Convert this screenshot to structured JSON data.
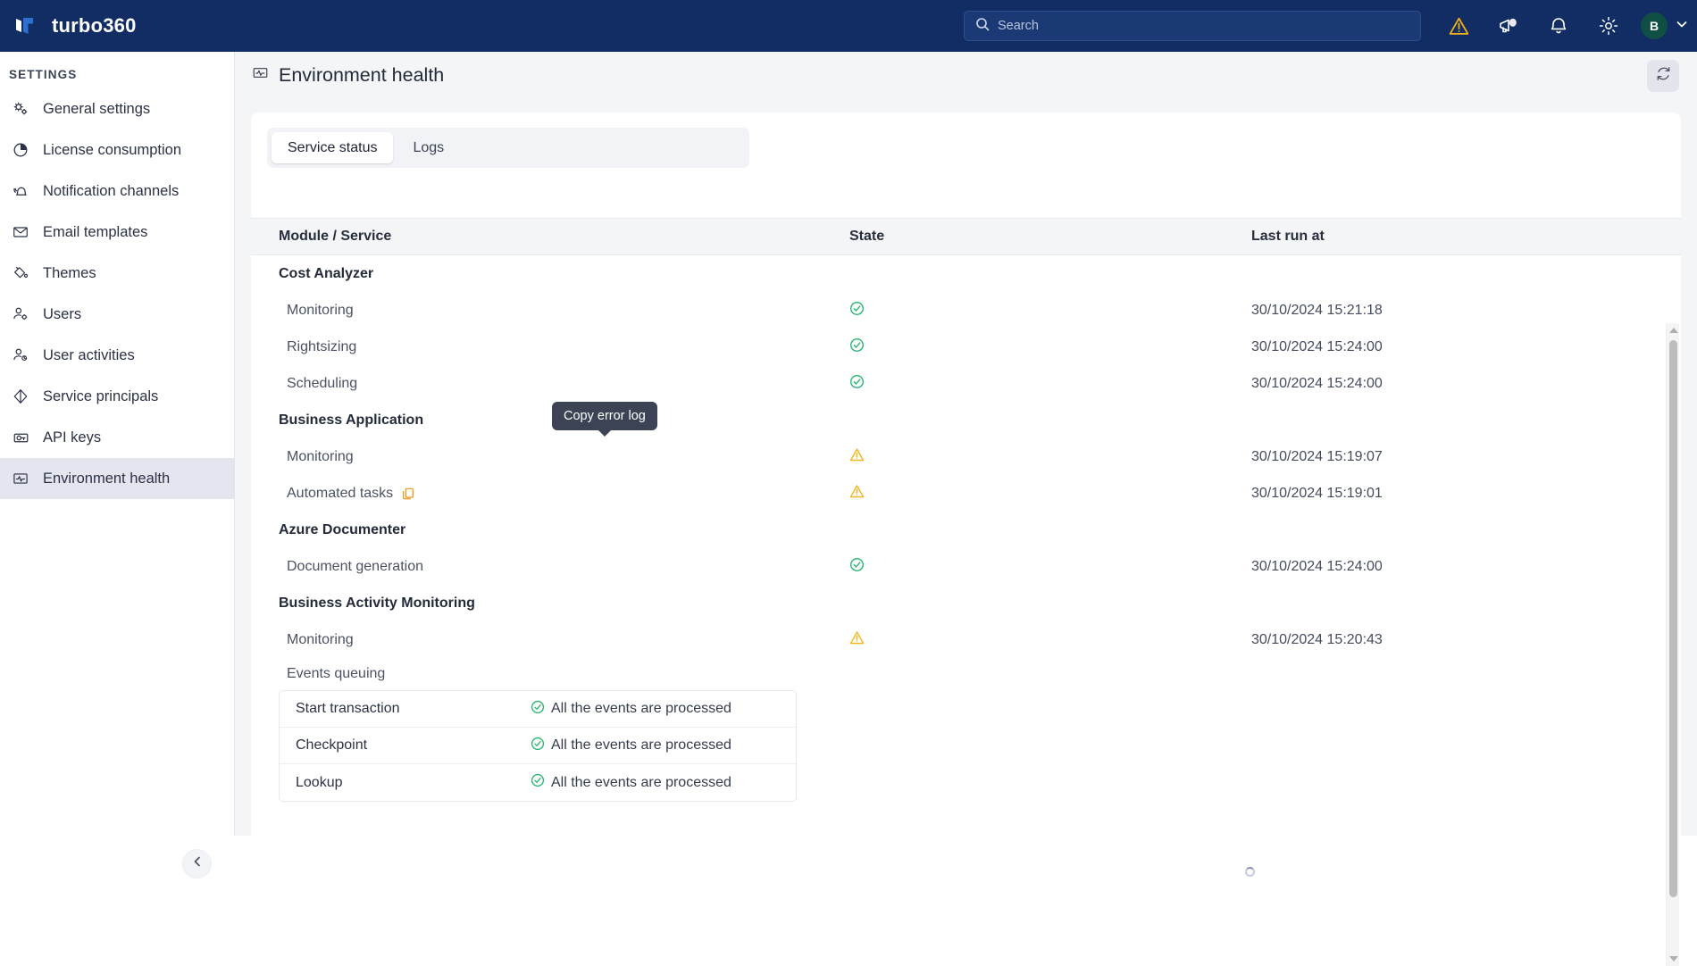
{
  "app": {
    "brand": "turbo360",
    "accent_navy": "#112d63",
    "status_ok": "#2bb673",
    "status_warn": "#f5b315",
    "copy_icon_color": "#f2920a"
  },
  "header": {
    "search": {
      "placeholder": "Search",
      "value": ""
    },
    "icons": [
      {
        "name": "alert-warning-icon",
        "label": "Alerts"
      },
      {
        "name": "announcement-icon",
        "label": "Announcements"
      },
      {
        "name": "bell-notification-icon",
        "label": "Notifications"
      },
      {
        "name": "gear-settings-icon",
        "label": "Settings"
      }
    ],
    "avatar": {
      "initial": "B"
    }
  },
  "sidebar": {
    "section_title": "SETTINGS",
    "items": [
      {
        "label": "General settings",
        "icon": "gears-icon",
        "active": false
      },
      {
        "label": "License consumption",
        "icon": "pie-chart-icon",
        "active": false
      },
      {
        "label": "Notification channels",
        "icon": "bell-cluster-icon",
        "active": false
      },
      {
        "label": "Email templates",
        "icon": "envelope-icon",
        "active": false
      },
      {
        "label": "Themes",
        "icon": "paint-bucket-icon",
        "active": false
      },
      {
        "label": "Users",
        "icon": "user-gear-icon",
        "active": false
      },
      {
        "label": "User activities",
        "icon": "user-clock-icon",
        "active": false
      },
      {
        "label": "Service principals",
        "icon": "diamond-icon",
        "active": false
      },
      {
        "label": "API keys",
        "icon": "key-card-icon",
        "active": false
      },
      {
        "label": "Environment health",
        "icon": "pulse-monitor-icon",
        "active": true
      }
    ],
    "collapse_label": "Collapse sidebar"
  },
  "page": {
    "title": "Environment health",
    "title_icon": "pulse-monitor-icon",
    "refresh_label": "Refresh"
  },
  "tabs": [
    {
      "label": "Service status",
      "active": true
    },
    {
      "label": "Logs",
      "active": false
    }
  ],
  "table": {
    "columns": [
      "Module / Service",
      "State",
      "Last run at"
    ],
    "groups": [
      {
        "name": "Cost Analyzer",
        "rows": [
          {
            "name": "Monitoring",
            "state": "ok",
            "last_run": "30/10/2024 15:21:18",
            "copy": false
          },
          {
            "name": "Rightsizing",
            "state": "ok",
            "last_run": "30/10/2024 15:24:00",
            "copy": false
          },
          {
            "name": "Scheduling",
            "state": "ok",
            "last_run": "30/10/2024 15:24:00",
            "copy": false
          }
        ]
      },
      {
        "name": "Business Application",
        "rows": [
          {
            "name": "Monitoring",
            "state": "warn",
            "last_run": "30/10/2024 15:19:07",
            "copy": false
          },
          {
            "name": "Automated tasks",
            "state": "warn",
            "last_run": "30/10/2024 15:19:01",
            "copy": true
          }
        ]
      },
      {
        "name": "Azure Documenter",
        "rows": [
          {
            "name": "Document generation",
            "state": "ok",
            "last_run": "30/10/2024 15:24:00",
            "copy": false
          }
        ]
      },
      {
        "name": "Business Activity Monitoring",
        "rows": [
          {
            "name": "Monitoring",
            "state": "warn",
            "last_run": "30/10/2024 15:20:43",
            "copy": false
          }
        ]
      }
    ],
    "events_queuing": {
      "label": "Events queuing",
      "rows": [
        {
          "name": "Start transaction",
          "status": "All the events are processed",
          "state": "ok"
        },
        {
          "name": "Checkpoint",
          "status": "All the events are processed",
          "state": "ok"
        },
        {
          "name": "Lookup",
          "status": "All the events are processed",
          "state": "ok"
        }
      ]
    }
  },
  "tooltip": {
    "text": "Copy error log"
  }
}
